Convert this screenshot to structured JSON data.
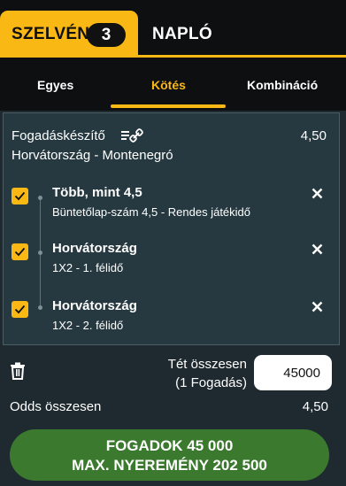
{
  "top_tabs": {
    "szelveny_label": "SZELVÉNY",
    "szelveny_count": "3",
    "naplo_label": "NAPLÓ"
  },
  "sub_tabs": [
    {
      "label": "Egyes",
      "active": false
    },
    {
      "label": "Kötés",
      "active": true
    },
    {
      "label": "Kombináció",
      "active": false
    }
  ],
  "bet_builder": {
    "title": "Fogadáskészítő",
    "icon": "bet-builder-icon",
    "odds": "4,50",
    "match": "Horvátország - Montenegró",
    "selections": [
      {
        "title": "Több, mint 4,5",
        "subtitle": "Büntetőlap-szám 4,5 - Rendes játékidő",
        "checked": true
      },
      {
        "title": "Horvátország",
        "subtitle": "1X2 - 1. félidő",
        "checked": true
      },
      {
        "title": "Horvátország",
        "subtitle": "1X2 - 2. félidő",
        "checked": true
      }
    ]
  },
  "stake": {
    "label_line1": "Tét összesen",
    "label_line2": "(1 Fogadás)",
    "value": "45000"
  },
  "odds_total": {
    "label": "Odds összesen",
    "value": "4,50"
  },
  "cta": {
    "line1": "FOGADOK 45 000",
    "line2": "MAX. NYEREMÉNY 202 500"
  },
  "colors": {
    "accent": "#f9b814",
    "background": "#1f2a30",
    "header": "#0d0f10",
    "cta": "#3b7a2e"
  }
}
